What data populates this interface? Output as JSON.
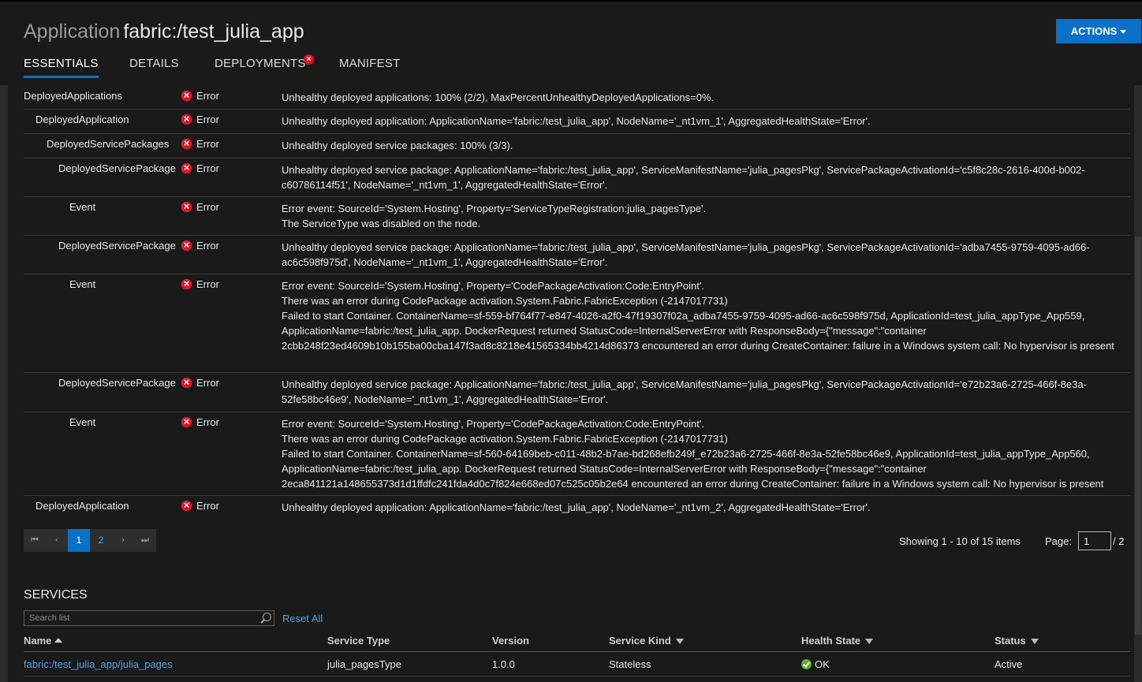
{
  "header": {
    "kind": "Application",
    "name": "fabric:/test_julia_app",
    "actions_label": "ACTIONS"
  },
  "tabs": [
    {
      "label": "ESSENTIALS",
      "active": true
    },
    {
      "label": "DETAILS"
    },
    {
      "label": "DEPLOYMENTS",
      "has_error": true
    },
    {
      "label": "MANIFEST"
    }
  ],
  "health_rows": [
    {
      "kind": "DeployedApplications",
      "state": "Error",
      "desc": [
        "Unhealthy deployed applications: 100% (2/2), MaxPercentUnhealthyDeployedApplications=0%."
      ]
    },
    {
      "kind": "DeployedApplication",
      "state": "Error",
      "desc": [
        "Unhealthy deployed application: ApplicationName='fabric:/test_julia_app', NodeName='_nt1vm_1', AggregatedHealthState='Error'."
      ]
    },
    {
      "kind": "DeployedServicePackages",
      "state": "Error",
      "desc": [
        "Unhealthy deployed service packages: 100% (3/3)."
      ]
    },
    {
      "kind": "DeployedServicePackage",
      "state": "Error",
      "desc": [
        "Unhealthy deployed service package: ApplicationName='fabric:/test_julia_app', ServiceManifestName='julia_pagesPkg', ServicePackageActivationId='c5f8c28c-2616-400d-b002-c60786114f51', NodeName='_nt1vm_1', AggregatedHealthState='Error'."
      ]
    },
    {
      "kind": "Event",
      "state": "Error",
      "desc": [
        "Error event: SourceId='System.Hosting', Property='ServiceTypeRegistration:julia_pagesType'.",
        "The ServiceType was disabled on the node."
      ]
    },
    {
      "kind": "DeployedServicePackage",
      "state": "Error",
      "desc": [
        "Unhealthy deployed service package: ApplicationName='fabric:/test_julia_app', ServiceManifestName='julia_pagesPkg', ServicePackageActivationId='adba7455-9759-4095-ad66-ac6c598f975d', NodeName='_nt1vm_1', AggregatedHealthState='Error'."
      ]
    },
    {
      "kind": "Event",
      "state": "Error",
      "desc": [
        "Error event: SourceId='System.Hosting', Property='CodePackageActivation:Code:EntryPoint'.",
        "There was an error during CodePackage activation.System.Fabric.FabricException (-2147017731)",
        "Failed to start Container. ContainerName=sf-559-bf764f77-e847-4026-a2f0-47f19307f02a_adba7455-9759-4095-ad66-ac6c598f975d, ApplicationId=test_julia_appType_App559, ApplicationName=fabric:/test_julia_app. DockerRequest returned StatusCode=InternalServerError with ResponseBody={\"message\":\"container 2cbb248f23ed4609b10b155ba00cba147f3ad8c8218e41565334bb4214d86373 encountered an error during CreateContainer: failure in a Windows system call: No hypervisor is present"
      ]
    },
    {
      "kind": "DeployedServicePackage",
      "state": "Error",
      "desc": [
        "Unhealthy deployed service package: ApplicationName='fabric:/test_julia_app', ServiceManifestName='julia_pagesPkg', ServicePackageActivationId='e72b23a6-2725-466f-8e3a-52fe58bc46e9', NodeName='_nt1vm_1', AggregatedHealthState='Error'."
      ]
    },
    {
      "kind": "Event",
      "state": "Error",
      "desc": [
        "Error event: SourceId='System.Hosting', Property='CodePackageActivation:Code:EntryPoint'.",
        "There was an error during CodePackage activation.System.Fabric.FabricException (-2147017731)",
        "Failed to start Container. ContainerName=sf-560-64169beb-c011-48b2-b7ae-bd268efb249f_e72b23a6-2725-466f-8e3a-52fe58bc46e9, ApplicationId=test_julia_appType_App560, ApplicationName=fabric:/test_julia_app. DockerRequest returned StatusCode=InternalServerError with ResponseBody={\"message\":\"container 2eca841121a148655373d1d1ffdfc241fda4d0c7f824e668ed07c525c05b2e64 encountered an error during CreateContainer: failure in a Windows system call: No hypervisor is present"
      ]
    },
    {
      "kind": "DeployedApplication",
      "state": "Error",
      "desc": [
        "Unhealthy deployed application: ApplicationName='fabric:/test_julia_app', NodeName='_nt1vm_2', AggregatedHealthState='Error'."
      ]
    }
  ],
  "pager": {
    "first": "⏮",
    "prev": "‹",
    "pages": [
      "1",
      "2"
    ],
    "current_page": "1",
    "next": "›",
    "last": "⏭",
    "showing": "Showing 1 - 10 of 15 items",
    "page_label": "Page:",
    "page_value": "1",
    "page_total": "/ 2"
  },
  "services": {
    "title": "SERVICES",
    "search_placeholder": "Search list",
    "reset_label": "Reset All",
    "columns": [
      "Name",
      "Service Type",
      "Version",
      "Service Kind",
      "Health State",
      "Status"
    ],
    "rows": [
      {
        "name": "fabric:/test_julia_app/julia_pages",
        "type": "julia_pagesType",
        "version": "1.0.0",
        "kind": "Stateless",
        "health": "OK",
        "status": "Active"
      }
    ]
  },
  "colors": {
    "accent": "#0a71c9",
    "error": "#e81123",
    "ok": "#5bb230",
    "link": "#4aa3e8"
  }
}
